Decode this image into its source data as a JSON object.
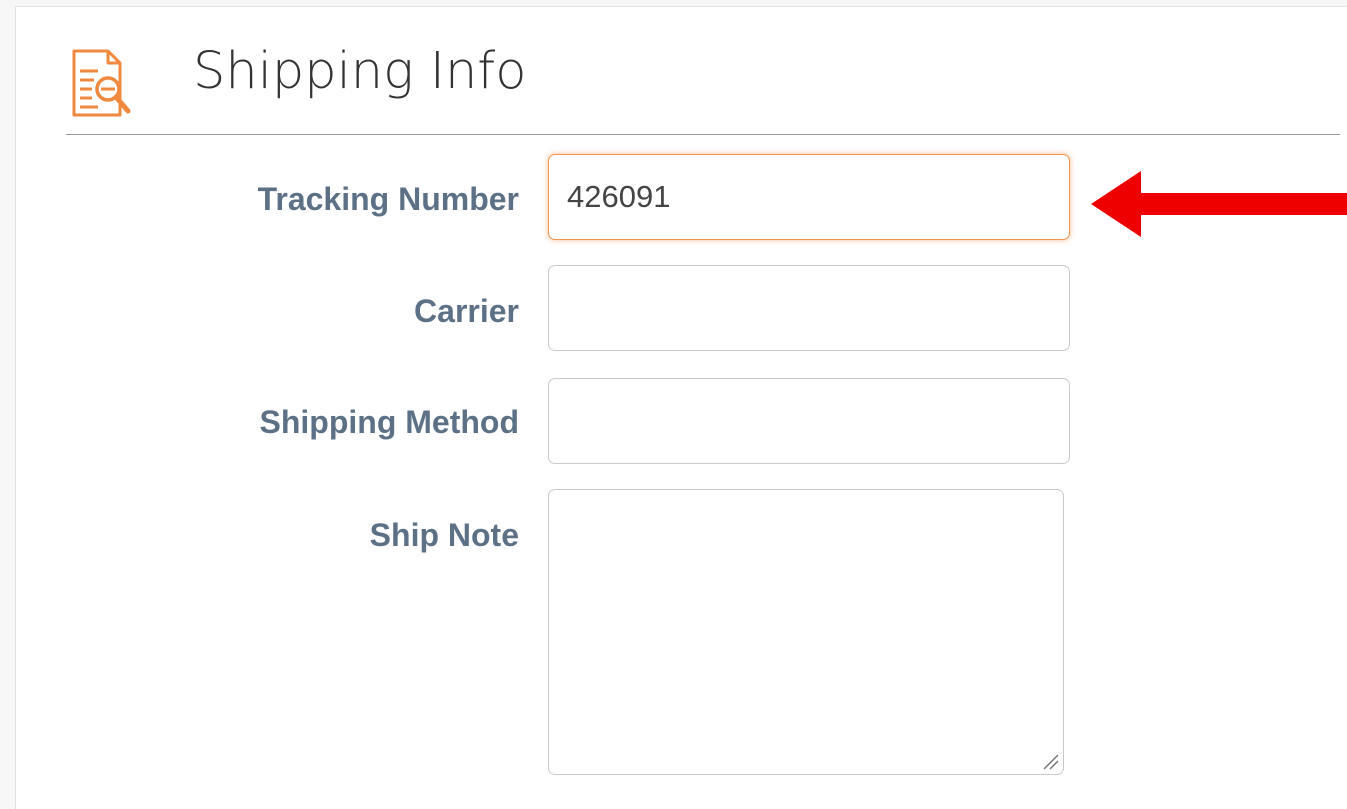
{
  "header": {
    "title": "Shipping Info",
    "icon": "document-search-icon",
    "icon_color": "#f0883e"
  },
  "form": {
    "fields": [
      {
        "label": "Tracking Number",
        "value": "426091",
        "focused": true
      },
      {
        "label": "Carrier",
        "value": ""
      },
      {
        "label": "Shipping Method",
        "value": ""
      }
    ],
    "note": {
      "label": "Ship Note",
      "value": ""
    }
  },
  "annotation": {
    "icon": "arrow-left-icon",
    "color": "#ee0000"
  },
  "colors": {
    "label": "#5d7186",
    "focus_border": "#f0944f"
  }
}
